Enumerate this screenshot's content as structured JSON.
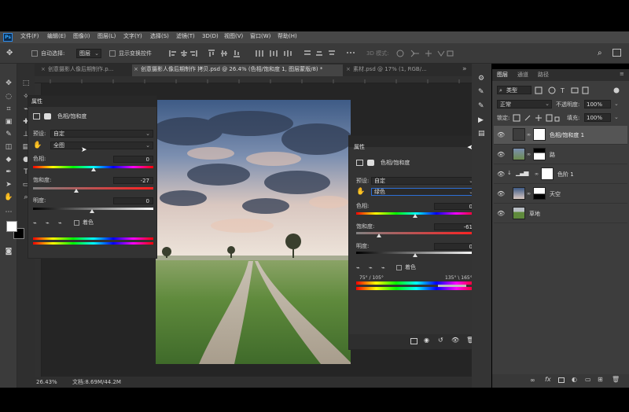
{
  "app": {
    "logo": "Ps"
  },
  "menu": [
    "文件(F)",
    "编辑(E)",
    "图像(I)",
    "图层(L)",
    "文字(Y)",
    "选择(S)",
    "滤镜(T)",
    "3D(D)",
    "视图(V)",
    "窗口(W)",
    "帮助(H)"
  ],
  "options": {
    "auto_select_label": "自动选择:",
    "auto_select_value": "图层",
    "show_transform_label": "显示变换控件",
    "mode_3d_label": "3D 模式:"
  },
  "tabs": [
    "创意摄影人像后期制作.p...",
    "创意摄影人像后期制作 拷贝.psd @ 26.4% (色相/饱和度 1, 图层蒙版/8) *",
    "素材.psd @ 17% (1, RGB/..."
  ],
  "status": {
    "zoom": "26.43%",
    "doc": "文档:8.69M/44.2M"
  },
  "props_left": {
    "title": "属性",
    "adjust_name": "色相/饱和度",
    "preset_label": "预设:",
    "preset_value": "自定",
    "channel_value": "全图",
    "hue_label": "色相:",
    "hue_value": "0",
    "sat_label": "饱和度:",
    "sat_value": "-27",
    "light_label": "明度:",
    "light_value": "0",
    "colorize_label": "着色"
  },
  "props_right": {
    "title": "属性",
    "adjust_name": "色相/饱和度",
    "preset_label": "预设:",
    "preset_value": "自定",
    "channel_value": "绿色",
    "hue_label": "色相:",
    "hue_value": "0",
    "sat_label": "饱和度:",
    "sat_value": "-61",
    "light_label": "明度:",
    "light_value": "0",
    "colorize_label": "着色",
    "range_left": "75° / 105°",
    "range_right": "135° \\ 165°"
  },
  "layers_panel": {
    "tabs": [
      "图层",
      "通道",
      "路径"
    ],
    "filter_kind": "类型",
    "blend_mode": "正常",
    "opacity_label": "不透明度:",
    "opacity_value": "100%",
    "lock_label": "锁定:",
    "fill_label": "填充:",
    "fill_value": "100%",
    "layers": [
      {
        "name": "色相/饱和度 1"
      },
      {
        "name": "路"
      },
      {
        "name": "色阶 1"
      },
      {
        "name": "天空"
      },
      {
        "name": "草地"
      }
    ]
  },
  "colors": {
    "accent": "#2d6fd6",
    "panel": "#333333",
    "canvas_bg": "#252525"
  }
}
